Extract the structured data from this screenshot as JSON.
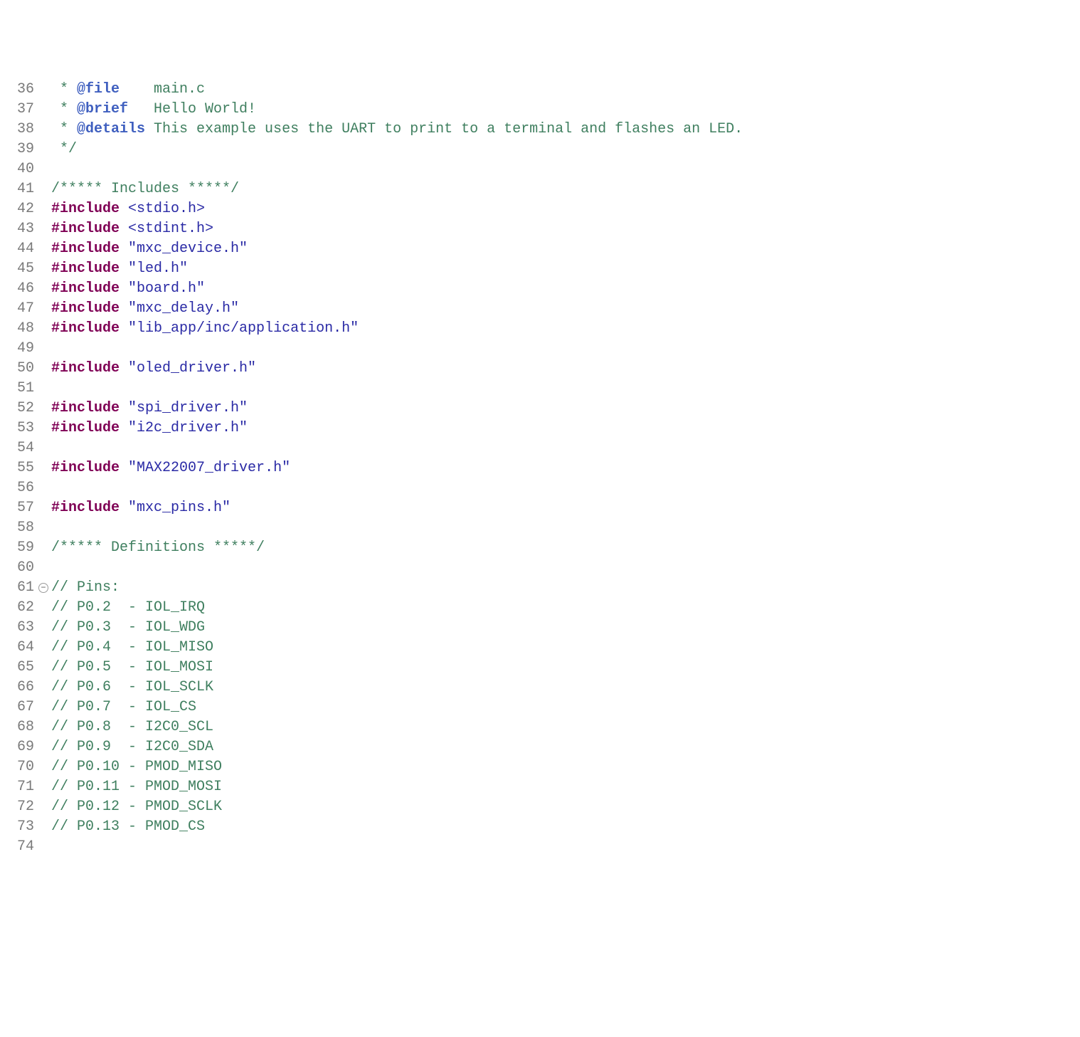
{
  "first_line_number": 36,
  "fold_line_index": 25,
  "lines": [
    {
      "tokens": [
        {
          "cls": "tok-comment",
          "t": " * "
        },
        {
          "cls": "tok-dockey",
          "t": "@file"
        },
        {
          "cls": "tok-comment",
          "t": "    main.c"
        }
      ]
    },
    {
      "tokens": [
        {
          "cls": "tok-comment",
          "t": " * "
        },
        {
          "cls": "tok-dockey",
          "t": "@brief"
        },
        {
          "cls": "tok-comment",
          "t": "   Hello World!"
        }
      ]
    },
    {
      "tokens": [
        {
          "cls": "tok-comment",
          "t": " * "
        },
        {
          "cls": "tok-dockey",
          "t": "@details"
        },
        {
          "cls": "tok-comment",
          "t": " This example uses the UART to print to a terminal and flashes an LED."
        }
      ]
    },
    {
      "tokens": [
        {
          "cls": "tok-comment",
          "t": " */"
        }
      ]
    },
    {
      "tokens": [
        {
          "cls": "tok-plain",
          "t": ""
        }
      ]
    },
    {
      "tokens": [
        {
          "cls": "tok-comment",
          "t": "/***** Includes *****/"
        }
      ]
    },
    {
      "tokens": [
        {
          "cls": "tok-keyword",
          "t": "#include"
        },
        {
          "cls": "tok-plain",
          "t": " "
        },
        {
          "cls": "tok-include",
          "t": "<stdio.h>"
        }
      ]
    },
    {
      "tokens": [
        {
          "cls": "tok-keyword",
          "t": "#include"
        },
        {
          "cls": "tok-plain",
          "t": " "
        },
        {
          "cls": "tok-include",
          "t": "<stdint.h>"
        }
      ]
    },
    {
      "tokens": [
        {
          "cls": "tok-keyword",
          "t": "#include"
        },
        {
          "cls": "tok-plain",
          "t": " "
        },
        {
          "cls": "tok-string",
          "t": "\"mxc_device.h\""
        }
      ]
    },
    {
      "tokens": [
        {
          "cls": "tok-keyword",
          "t": "#include"
        },
        {
          "cls": "tok-plain",
          "t": " "
        },
        {
          "cls": "tok-string",
          "t": "\"led.h\""
        }
      ]
    },
    {
      "tokens": [
        {
          "cls": "tok-keyword",
          "t": "#include"
        },
        {
          "cls": "tok-plain",
          "t": " "
        },
        {
          "cls": "tok-string",
          "t": "\"board.h\""
        }
      ]
    },
    {
      "tokens": [
        {
          "cls": "tok-keyword",
          "t": "#include"
        },
        {
          "cls": "tok-plain",
          "t": " "
        },
        {
          "cls": "tok-string",
          "t": "\"mxc_delay.h\""
        }
      ]
    },
    {
      "tokens": [
        {
          "cls": "tok-keyword",
          "t": "#include"
        },
        {
          "cls": "tok-plain",
          "t": " "
        },
        {
          "cls": "tok-string",
          "t": "\"lib_app/inc/application.h\""
        }
      ]
    },
    {
      "tokens": [
        {
          "cls": "tok-plain",
          "t": ""
        }
      ]
    },
    {
      "tokens": [
        {
          "cls": "tok-keyword",
          "t": "#include"
        },
        {
          "cls": "tok-plain",
          "t": " "
        },
        {
          "cls": "tok-string",
          "t": "\"oled_driver.h\""
        }
      ]
    },
    {
      "tokens": [
        {
          "cls": "tok-plain",
          "t": ""
        }
      ]
    },
    {
      "tokens": [
        {
          "cls": "tok-keyword",
          "t": "#include"
        },
        {
          "cls": "tok-plain",
          "t": " "
        },
        {
          "cls": "tok-string",
          "t": "\"spi_driver.h\""
        }
      ]
    },
    {
      "tokens": [
        {
          "cls": "tok-keyword",
          "t": "#include"
        },
        {
          "cls": "tok-plain",
          "t": " "
        },
        {
          "cls": "tok-string",
          "t": "\"i2c_driver.h\""
        }
      ]
    },
    {
      "tokens": [
        {
          "cls": "tok-plain",
          "t": ""
        }
      ]
    },
    {
      "tokens": [
        {
          "cls": "tok-keyword",
          "t": "#include"
        },
        {
          "cls": "tok-plain",
          "t": " "
        },
        {
          "cls": "tok-string",
          "t": "\"MAX22007_driver.h\""
        }
      ]
    },
    {
      "tokens": [
        {
          "cls": "tok-plain",
          "t": ""
        }
      ]
    },
    {
      "tokens": [
        {
          "cls": "tok-keyword",
          "t": "#include"
        },
        {
          "cls": "tok-plain",
          "t": " "
        },
        {
          "cls": "tok-string",
          "t": "\"mxc_pins.h\""
        }
      ]
    },
    {
      "tokens": [
        {
          "cls": "tok-plain",
          "t": ""
        }
      ]
    },
    {
      "tokens": [
        {
          "cls": "tok-comment",
          "t": "/***** Definitions *****/"
        }
      ]
    },
    {
      "tokens": [
        {
          "cls": "tok-plain",
          "t": ""
        }
      ]
    },
    {
      "tokens": [
        {
          "cls": "tok-comment",
          "t": "// Pins:"
        }
      ]
    },
    {
      "tokens": [
        {
          "cls": "tok-comment",
          "t": "// P0.2  - IOL_IRQ"
        }
      ]
    },
    {
      "tokens": [
        {
          "cls": "tok-comment",
          "t": "// P0.3  - IOL_WDG"
        }
      ]
    },
    {
      "tokens": [
        {
          "cls": "tok-comment",
          "t": "// P0.4  - IOL_MISO"
        }
      ]
    },
    {
      "tokens": [
        {
          "cls": "tok-comment",
          "t": "// P0.5  - IOL_MOSI"
        }
      ]
    },
    {
      "tokens": [
        {
          "cls": "tok-comment",
          "t": "// P0.6  - IOL_SCLK"
        }
      ]
    },
    {
      "tokens": [
        {
          "cls": "tok-comment",
          "t": "// P0.7  - IOL_CS"
        }
      ]
    },
    {
      "tokens": [
        {
          "cls": "tok-comment",
          "t": "// P0.8  - I2C0_SCL"
        }
      ]
    },
    {
      "tokens": [
        {
          "cls": "tok-comment",
          "t": "// P0.9  - I2C0_SDA"
        }
      ]
    },
    {
      "tokens": [
        {
          "cls": "tok-comment",
          "t": "// P0.10 - PMOD_MISO"
        }
      ]
    },
    {
      "tokens": [
        {
          "cls": "tok-comment",
          "t": "// P0.11 - PMOD_MOSI"
        }
      ]
    },
    {
      "tokens": [
        {
          "cls": "tok-comment",
          "t": "// P0.12 - PMOD_SCLK"
        }
      ]
    },
    {
      "tokens": [
        {
          "cls": "tok-comment",
          "t": "// P0.13 - PMOD_CS"
        }
      ]
    },
    {
      "tokens": [
        {
          "cls": "tok-plain",
          "t": ""
        }
      ]
    }
  ],
  "fold_glyph": "⊖"
}
